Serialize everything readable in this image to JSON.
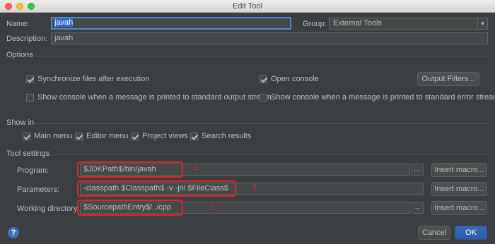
{
  "window": {
    "title": "Edit Tool"
  },
  "name_label": "Name:",
  "name_value": "javah",
  "group_label": "Group:",
  "group_value": "External Tools",
  "description_label": "Description:",
  "description_value": "javah",
  "options": {
    "heading": "Options",
    "sync_label": "Synchronize files after execution",
    "sync_checked": true,
    "open_console_label": "Open console",
    "open_console_checked": true,
    "output_filters_label": "Output Filters...",
    "console_stdout_label": "Show console when a message is printed to standard output stream",
    "console_stdout_checked": false,
    "console_stderr_label": "Show console when a message is printed to standard error stream",
    "console_stderr_checked": false
  },
  "show_in": {
    "heading": "Show in",
    "items": [
      {
        "label": "Main menu",
        "checked": true
      },
      {
        "label": "Editor menu",
        "checked": true
      },
      {
        "label": "Project views",
        "checked": true
      },
      {
        "label": "Search results",
        "checked": true
      }
    ]
  },
  "tool_settings": {
    "heading": "Tool settings",
    "program_label": "Program:",
    "program_value": "$JDKPath$/bin/javah",
    "parameters_label": "Parameters:",
    "parameters_value": "-classpath $Classpath$ -v -jni $FileClass$",
    "workdir_label": "Working directory:",
    "workdir_value": "$SourcepathEntry$/../cpp",
    "browse_label": "...",
    "insert_macro_label": "Insert macro..."
  },
  "annotations": [
    "1",
    "2",
    "3"
  ],
  "buttons": {
    "help": "?",
    "cancel": "Cancel",
    "ok": "OK"
  },
  "colors": {
    "background": "#3c3f41",
    "accent": "#2f65ca",
    "annotation": "#e0242f"
  },
  "icons": {
    "dropdown": "chevron-down-icon",
    "help": "help-icon"
  }
}
